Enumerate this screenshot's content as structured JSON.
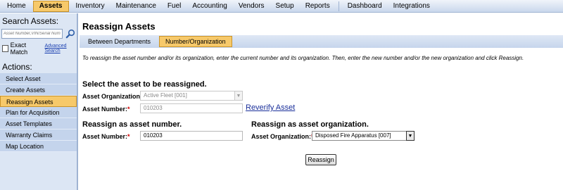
{
  "menu": {
    "items": [
      {
        "label": "Home"
      },
      {
        "label": "Assets",
        "active": true
      },
      {
        "label": "Inventory"
      },
      {
        "label": "Maintenance"
      },
      {
        "label": "Fuel"
      },
      {
        "label": "Accounting"
      },
      {
        "label": "Vendors"
      },
      {
        "label": "Setup"
      },
      {
        "label": "Reports"
      }
    ],
    "items_right": [
      {
        "label": "Dashboard"
      },
      {
        "label": "Integrations"
      }
    ]
  },
  "sidebar": {
    "search_title": "Search Assets:",
    "search_placeholder": "Asset Number,VIN/Serial Number",
    "exact_match_label": "Exact Match",
    "advanced_search_label": "Advanced Search",
    "actions_title": "Actions:",
    "actions": [
      {
        "label": "Select Asset"
      },
      {
        "label": "Create Assets"
      },
      {
        "label": "Reassign Assets",
        "active": true
      },
      {
        "label": "Plan for Acquisition"
      },
      {
        "label": "Asset Templates"
      },
      {
        "label": "Warranty Claims"
      },
      {
        "label": "Map Location"
      }
    ]
  },
  "main": {
    "title": "Reassign Assets",
    "tabs": [
      {
        "label": "Between Departments"
      },
      {
        "label": "Number/Organization",
        "active": true
      }
    ],
    "instructions": "To reassign the asset number and/or its organization, enter the current number and its organization. Then, enter the new number and/or the new organization and click Reassign.",
    "select_section_title": "Select the asset to be reassigned.",
    "current_org_label": "Asset Organization:",
    "current_org_value": "Active Fleet [001]",
    "current_number_label": "Asset Number:",
    "current_number_value": "010203",
    "reverify_label": "Reverify Asset",
    "new_number_section_title": "Reassign as asset number.",
    "new_number_label": "Asset Number:",
    "new_number_value": "010203",
    "new_org_section_title": "Reassign as asset organization.",
    "new_org_label": "Asset Organization:",
    "new_org_value": "Disposed Fire Apparatus [007]",
    "reassign_button": "Reassign",
    "required_mark": "*"
  }
}
